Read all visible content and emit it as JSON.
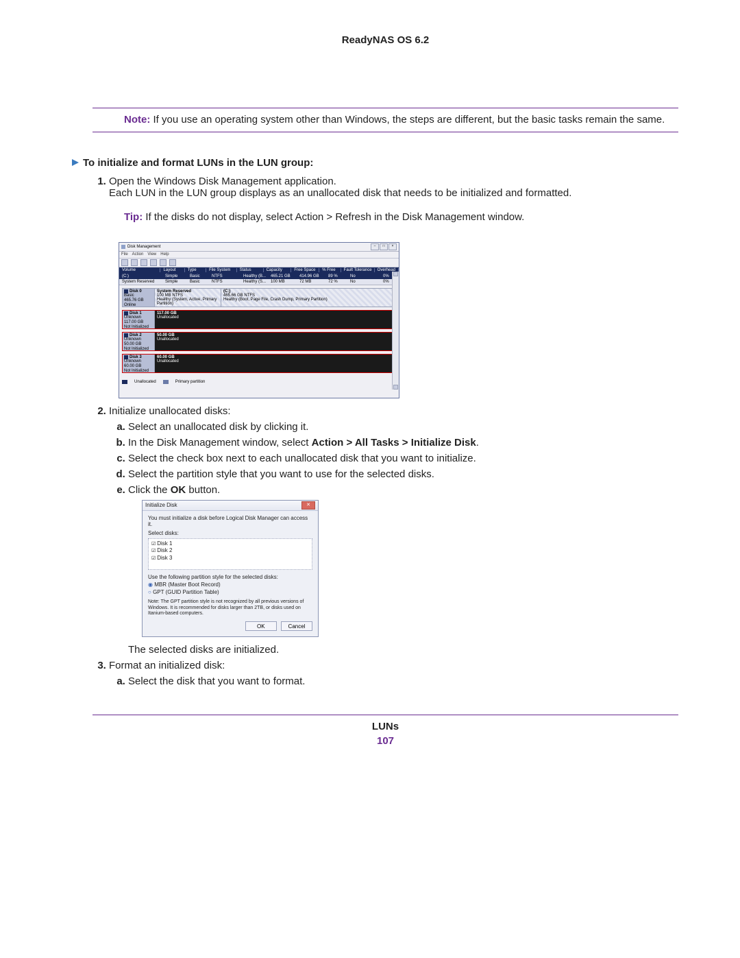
{
  "doc_title": "ReadyNAS OS 6.2",
  "note": {
    "label": "Note:",
    "text": "If you use an operating system other than Windows, the steps are different, but the basic tasks remain the same."
  },
  "section_heading": "To initialize and format LUNs in the LUN group:",
  "steps": {
    "s1_a": "Open the Windows Disk Management application.",
    "s1_b": "Each LUN in the LUN group displays as an unallocated disk that needs to be initialized and formatted.",
    "tip_label": "Tip:",
    "tip_text": "If the disks do not display, select Action > Refresh in the Disk Management window.",
    "s2_intro": "Initialize unallocated disks:",
    "s2_a": "Select an unallocated disk by clicking it.",
    "s2_b_pre": "In the Disk Management window, select ",
    "s2_b_bold": "Action > All Tasks > Initialize Disk",
    "s2_b_post": ".",
    "s2_c": "Select the check box next to each unallocated disk that you want to initialize.",
    "s2_d": "Select the partition style that you want to use for the selected disks.",
    "s2_e_pre": "Click the ",
    "s2_e_bold": "OK",
    "s2_e_post": " button.",
    "s2_result": "The selected disks are initialized.",
    "s3_intro": "Format an initialized disk:",
    "s3_a": "Select the disk that you want to format."
  },
  "dm": {
    "title": "Disk Management",
    "menu": [
      "File",
      "Action",
      "View",
      "Help"
    ],
    "headers": [
      "Volume",
      "Layout",
      "Type",
      "File System",
      "Status",
      "Capacity",
      "Free Space",
      "% Free",
      "Fault Tolerance",
      "Overhead"
    ],
    "rows": [
      [
        "(C:)",
        "Simple",
        "Basic",
        "NTFS",
        "Healthy (B...",
        "465.21 GB",
        "414.96 GB",
        "89 %",
        "No",
        "0%"
      ],
      [
        "System Reserved",
        "Simple",
        "Basic",
        "NTFS",
        "Healthy (S...",
        "100 MB",
        "72 MB",
        "72 %",
        "No",
        "0%"
      ]
    ],
    "disks": [
      {
        "name": "Disk 0",
        "info": "Basic\n465.76 GB\nOnline",
        "parts": [
          {
            "label": "System Reserved",
            "sub": "100 MB NTFS\nHealthy (System, Active, Primary Partition)",
            "cls": "sys"
          },
          {
            "label": "(C:)",
            "sub": "465.66 GB NTFS\nHealthy (Boot, Page File, Crash Dump, Primary Partition)",
            "cls": "sys"
          }
        ]
      },
      {
        "name": "Disk 1",
        "info": "Unknown\n117.00 GB\nNot Initialized",
        "parts": [
          {
            "label": "117.00 GB",
            "sub": "Unallocated",
            "cls": "unalloc"
          }
        ],
        "hl": true
      },
      {
        "name": "Disk 2",
        "info": "Unknown\n50.00 GB\nNot Initialized",
        "parts": [
          {
            "label": "50.00 GB",
            "sub": "Unallocated",
            "cls": "unalloc"
          }
        ],
        "hl": true
      },
      {
        "name": "Disk 3",
        "info": "Unknown\n60.00 GB\nNot Initialized",
        "parts": [
          {
            "label": "60.00 GB",
            "sub": "Unallocated",
            "cls": "unalloc"
          }
        ],
        "hl": true
      }
    ],
    "legend": [
      "Unallocated",
      "Primary partition"
    ]
  },
  "id": {
    "title": "Initialize Disk",
    "msg": "You must initialize a disk before Logical Disk Manager can access it.",
    "select_label": "Select disks:",
    "disks": [
      "Disk 1",
      "Disk 2",
      "Disk 3"
    ],
    "style_label": "Use the following partition style for the selected disks:",
    "radios": [
      {
        "label": "MBR (Master Boot Record)",
        "selected": true
      },
      {
        "label": "GPT (GUID Partition Table)",
        "selected": false
      }
    ],
    "note": "Note: The GPT partition style is not recognized by all previous versions of Windows. It is recommended for disks larger than 2TB, or disks used on Itanium-based computers.",
    "ok": "OK",
    "cancel": "Cancel"
  },
  "footer": {
    "section": "LUNs",
    "page": "107"
  }
}
